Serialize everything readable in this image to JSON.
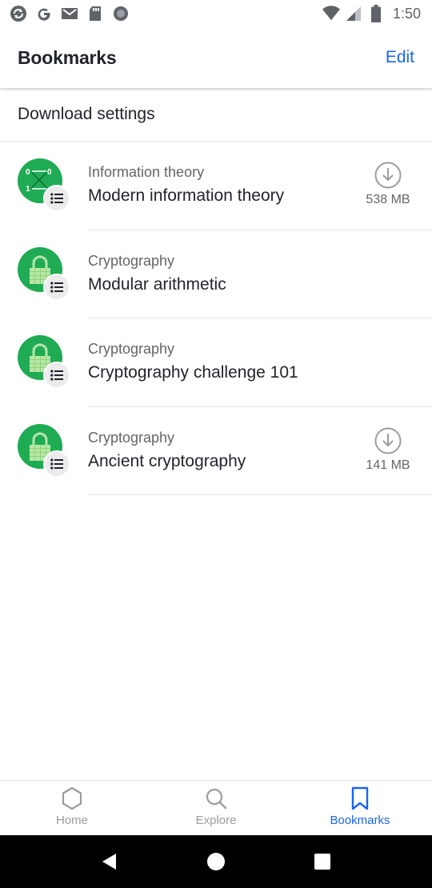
{
  "status_bar": {
    "time": "1:50",
    "icons": [
      "sync-icon",
      "google-icon",
      "gmail-icon",
      "sd-card-icon",
      "record-icon",
      "wifi-icon",
      "signal-icon",
      "battery-icon"
    ]
  },
  "header": {
    "title": "Bookmarks",
    "edit_label": "Edit"
  },
  "download_settings": {
    "label": "Download settings"
  },
  "bookmarks": [
    {
      "subject": "Information theory",
      "title": "Modern information theory",
      "icon": "information-theory-icon",
      "download_size": "538 MB"
    },
    {
      "subject": "Cryptography",
      "title": "Modular arithmetic",
      "icon": "lock-icon"
    },
    {
      "subject": "Cryptography",
      "title": "Cryptography challenge 101",
      "icon": "lock-icon"
    },
    {
      "subject": "Cryptography",
      "title": "Ancient cryptography",
      "icon": "lock-icon",
      "download_size": "141 MB"
    }
  ],
  "bottom_nav": {
    "tabs": [
      {
        "label": "Home",
        "icon": "hexagon-icon"
      },
      {
        "label": "Explore",
        "icon": "search-icon"
      },
      {
        "label": "Bookmarks",
        "icon": "bookmark-icon",
        "active": true
      }
    ]
  },
  "colors": {
    "accent": "#1865f2",
    "avatar_green": "#1fab54",
    "text_primary": "#21242c",
    "text_secondary": "#626569"
  }
}
